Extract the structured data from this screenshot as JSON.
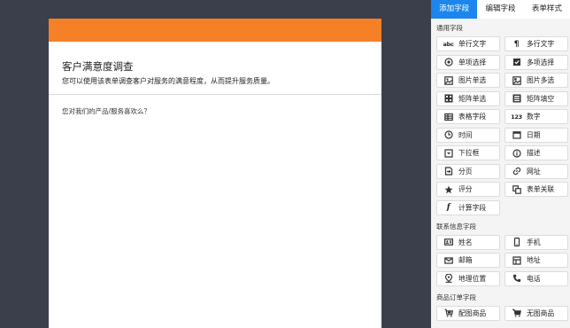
{
  "form": {
    "title": "客户满意度调查",
    "description": "您可以使用该表单调查客户对服务的满意程度，从而提升服务质量。",
    "question": "您对我们的产品/服务喜欢么？",
    "accent_color": "#f68025"
  },
  "panel": {
    "tabs": [
      {
        "label": "添加字段",
        "active": true
      },
      {
        "label": "编辑字段",
        "active": false
      },
      {
        "label": "表单样式",
        "active": false
      }
    ],
    "accent_color": "#1c86ee",
    "sections": [
      {
        "title": "通用字段",
        "fields": [
          {
            "label": "单行文字",
            "icon": "abc-icon",
            "icon_text": "abc"
          },
          {
            "label": "多行文字",
            "icon": "paragraph-icon",
            "icon_text": "¶"
          },
          {
            "label": "单项选择",
            "icon": "radio-icon"
          },
          {
            "label": "多项选择",
            "icon": "checkbox-icon"
          },
          {
            "label": "图片单选",
            "icon": "image-radio-icon"
          },
          {
            "label": "图片多选",
            "icon": "image-checkbox-icon"
          },
          {
            "label": "矩阵单选",
            "icon": "matrix-radio-icon"
          },
          {
            "label": "矩阵填空",
            "icon": "matrix-fill-icon"
          },
          {
            "label": "表格字段",
            "icon": "table-icon"
          },
          {
            "label": "数字",
            "icon": "number-icon",
            "icon_text": "123"
          },
          {
            "label": "时间",
            "icon": "clock-icon"
          },
          {
            "label": "日期",
            "icon": "calendar-icon"
          },
          {
            "label": "下拉框",
            "icon": "dropdown-icon"
          },
          {
            "label": "描述",
            "icon": "info-icon"
          },
          {
            "label": "分页",
            "icon": "page-break-icon"
          },
          {
            "label": "网址",
            "icon": "link-icon"
          },
          {
            "label": "评分",
            "icon": "star-icon"
          },
          {
            "label": "表单关联",
            "icon": "form-link-icon"
          },
          {
            "label": "计算字段",
            "icon": "function-icon",
            "icon_text": "f"
          }
        ]
      },
      {
        "title": "联系信息字段",
        "fields": [
          {
            "label": "姓名",
            "icon": "id-card-icon"
          },
          {
            "label": "手机",
            "icon": "mobile-icon"
          },
          {
            "label": "邮箱",
            "icon": "mail-icon"
          },
          {
            "label": "地址",
            "icon": "address-icon"
          },
          {
            "label": "地理位置",
            "icon": "location-icon"
          },
          {
            "label": "电话",
            "icon": "phone-icon"
          }
        ]
      },
      {
        "title": "商品订单字段",
        "fields": [
          {
            "label": "配图商品",
            "icon": "cart-image-icon"
          },
          {
            "label": "无图商品",
            "icon": "cart-icon"
          }
        ]
      }
    ]
  }
}
